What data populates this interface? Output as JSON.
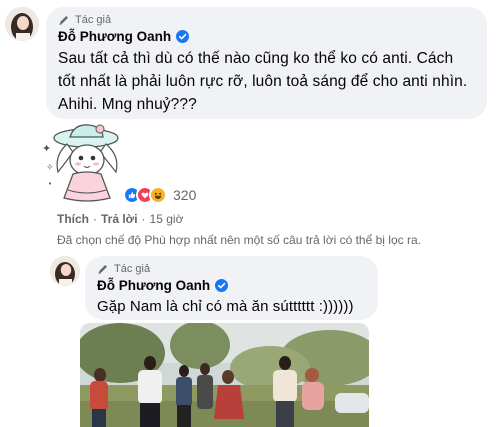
{
  "comment1": {
    "author_tag": "Tác giả",
    "author_name": "Đỗ Phương Oanh",
    "text": "Sau tất cả thì dù có thế nào cũng ko thể ko có anti. Cách tốt nhất là phải luôn rực rỡ, luôn toả sáng để cho anti nhìn. Ahihi. Mng nhuỷ???",
    "reactions": {
      "icons": [
        "like-icon",
        "love-icon",
        "haha-icon"
      ],
      "count": "320"
    },
    "actions": {
      "like": "Thích",
      "reply": "Trả lời",
      "time": "15 giờ"
    }
  },
  "filter_note": "Đã chọn chế độ Phù hợp nhất nên một số câu trả lời có thể bị lọc ra.",
  "reply1": {
    "author_tag": "Tác giả",
    "author_name": "Đỗ Phương Oanh",
    "text": "Gặp Nam là chỉ có mà ăn sútttttt :))))))"
  },
  "colors": {
    "bubble_bg": "#f0f2f5",
    "verified_blue": "#1877f2",
    "secondary_text": "#65676b"
  }
}
